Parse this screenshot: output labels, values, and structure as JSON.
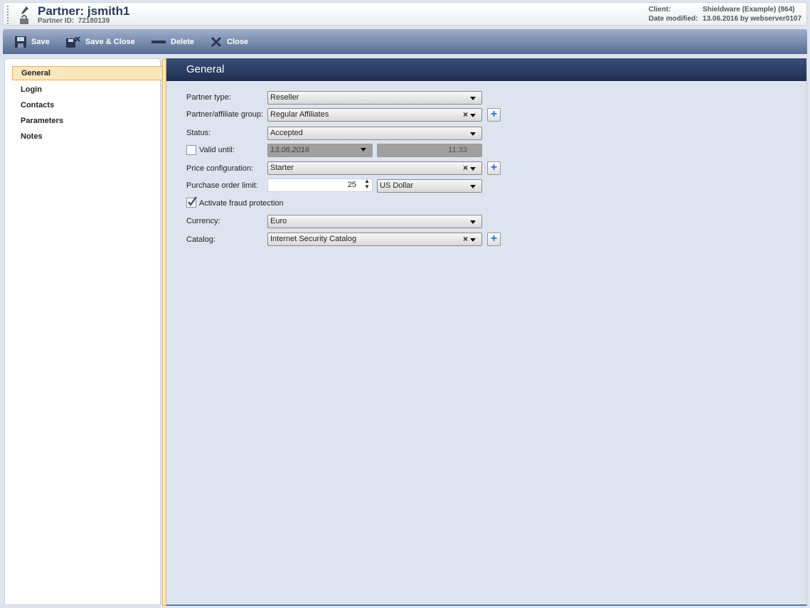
{
  "header": {
    "title": "Partner: jsmith1",
    "partner_id_label": "Partner ID:",
    "partner_id": "72180139",
    "client_label": "Client:",
    "client_value": "Shieldware (Example) (864)",
    "modified_label": "Date modified:",
    "modified_value": "13.06.2016 by webserver0107"
  },
  "toolbar": {
    "save": "Save",
    "save_close": "Save & Close",
    "delete": "Delete",
    "close": "Close"
  },
  "sidebar": {
    "items": [
      {
        "label": "General"
      },
      {
        "label": "Login"
      },
      {
        "label": "Contacts"
      },
      {
        "label": "Parameters"
      },
      {
        "label": "Notes"
      }
    ]
  },
  "main": {
    "title": "General"
  },
  "form": {
    "partner_type": {
      "label": "Partner type:",
      "value": "Reseller"
    },
    "group": {
      "label": "Partner/affiliate group:",
      "value": "Regular Affiliates"
    },
    "status": {
      "label": "Status:",
      "value": "Accepted"
    },
    "valid_until": {
      "label": "Valid until:",
      "checked": false,
      "date": "13.06.2016",
      "time": "11:33"
    },
    "price_config": {
      "label": "Price configuration:",
      "value": "Starter"
    },
    "po_limit": {
      "label": "Purchase order limit:",
      "value": "25",
      "currency": "US Dollar"
    },
    "fraud": {
      "label": "Activate fraud protection",
      "checked": true
    },
    "currency": {
      "label": "Currency:",
      "value": "Euro"
    },
    "catalog": {
      "label": "Catalog:",
      "value": "Internet Security Catalog"
    }
  },
  "colors": {
    "toolbar": "#566b92",
    "header": "#1e2f50",
    "active_nav": "#fbe7bd",
    "accent": "#e8b250"
  }
}
